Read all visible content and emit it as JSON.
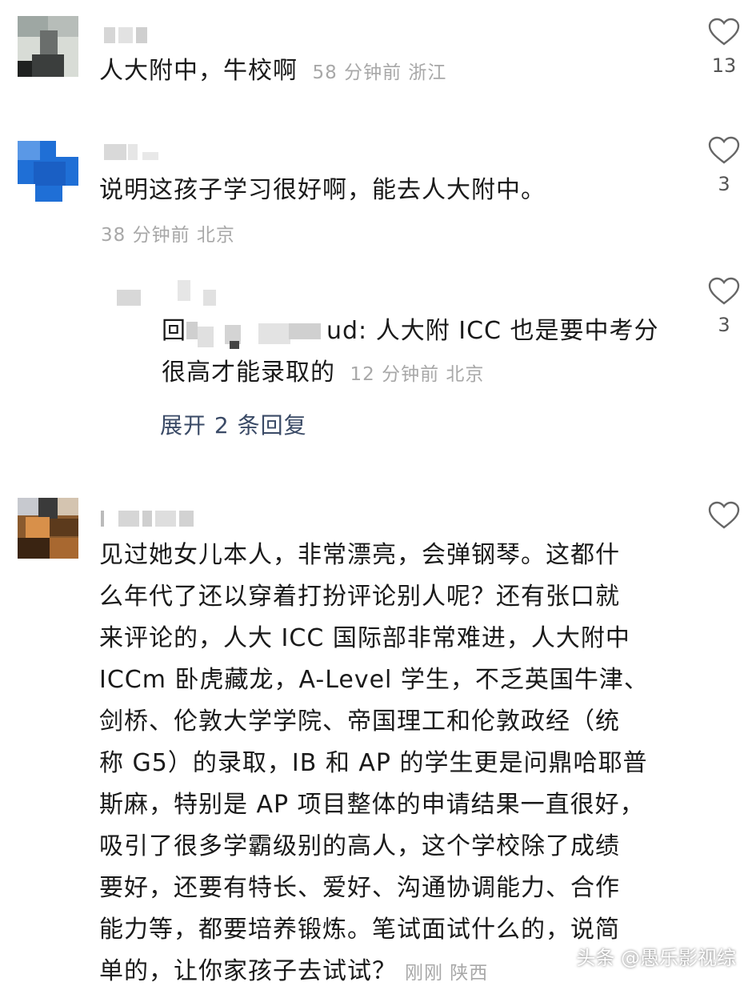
{
  "comments": [
    {
      "text": "人大附中，牛校啊",
      "meta": "58 分钟前  浙江",
      "likes": "13"
    },
    {
      "text": "说明这孩子学习很好啊，能去人大附中。",
      "meta": "38 分钟前  北京",
      "likes": "3",
      "reply": {
        "prefix": "回",
        "text_suffix": "ud: 人大附 ICC 也是要中考分",
        "text_line2": "很高才能录取的",
        "meta": "12 分钟前  北京",
        "likes": "3"
      },
      "expand": "展开 2 条回复"
    },
    {
      "lines": [
        "见过她女儿本人，非常漂亮，会弹钢琴。这都什",
        "么年代了还以穿着打扮评论别人呢？还有张口就",
        "来评论的，人大 ICC 国际部非常难进，人大附中",
        "ICCm 卧虎藏龙，A-Level 学生，不乏英国牛津、",
        "剑桥、伦敦大学学院、帝国理工和伦敦政经（统",
        "称 G5）的录取，IB 和 AP 的学生更是问鼎哈耶普",
        "斯麻，特别是 AP 项目整体的申请结果一直很好，",
        "吸引了很多学霸级别的高人，这个学校除了成绩",
        "要好，还要有特长、爱好、沟通协调能力、合作",
        "能力等，都要培养锻炼。笔试面试什么的，说简",
        "单的，让你家孩子去试试？"
      ],
      "meta": "刚刚  陕西"
    }
  ],
  "watermark": "头条 @愚乐影视综"
}
